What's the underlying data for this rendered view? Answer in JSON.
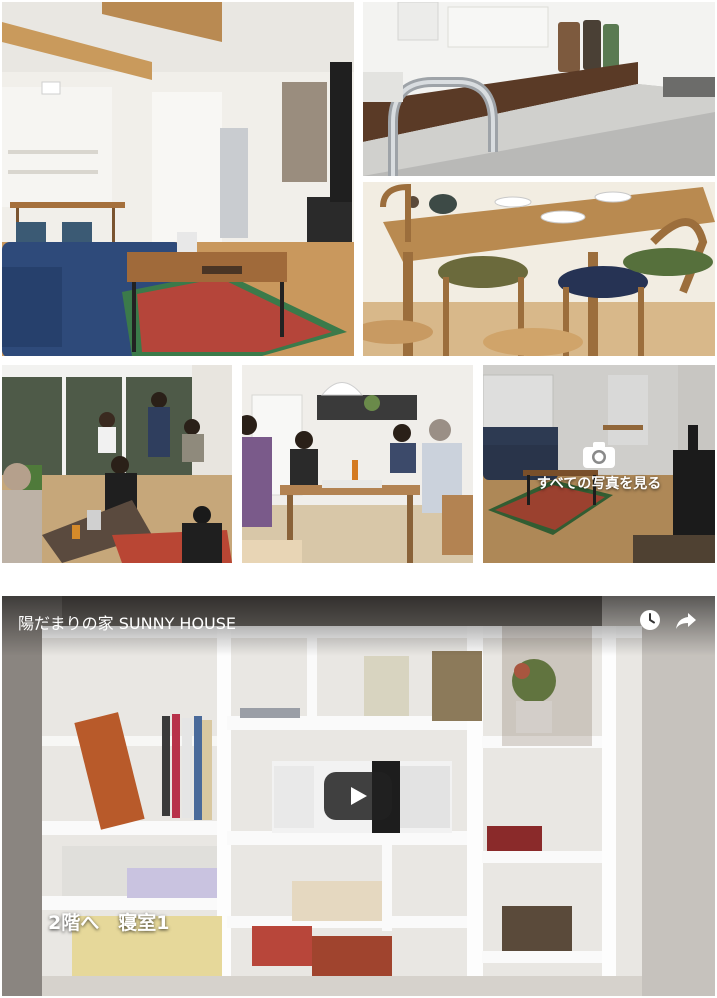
{
  "gallery": {
    "photos": [
      {
        "subject": "living-room-with-wood-stove"
      },
      {
        "subject": "kitchen-faucet-counter"
      },
      {
        "subject": "dining-table-chairs"
      },
      {
        "subject": "gathering-by-window"
      },
      {
        "subject": "group-at-table"
      },
      {
        "subject": "living-room-view"
      }
    ],
    "see_all_label": "すべての写真を見る",
    "see_all_icon": "camera-icon"
  },
  "video": {
    "title": "陽だまりの家 SUNNY HOUSE",
    "caption": "2階へ　寝室1",
    "watch_later_icon": "clock-icon",
    "share_icon": "share-arrow-icon",
    "play_icon": "play-icon",
    "colors": {
      "play_button": "#212121",
      "text": "#ffffff"
    }
  }
}
